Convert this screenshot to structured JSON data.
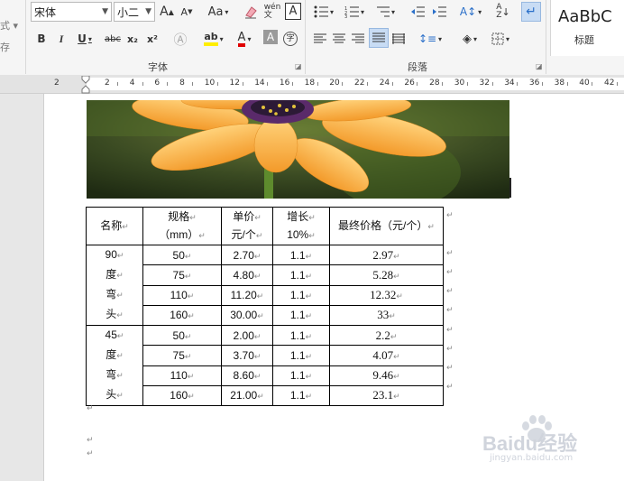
{
  "ribbon": {
    "left_cut": [
      "式 ▾",
      "存"
    ],
    "font_name": "宋体",
    "font_size": "小二",
    "grow_font": "A",
    "shrink_font": "A",
    "change_case": "Aa",
    "row1_icons": [
      "clear-format-icon",
      "phonetic-guide-icon",
      "char-border-icon"
    ],
    "bold": "B",
    "italic": "I",
    "underline": "U",
    "strike": "abc",
    "subscript": "x₂",
    "superscript": "x²",
    "group_font": "字体",
    "group_paragraph": "段落",
    "style_sample": "AaBbC",
    "style_name": "标题"
  },
  "ruler": {
    "labels": [
      "2",
      "2",
      "4",
      "6",
      "8",
      "10",
      "12",
      "14",
      "16",
      "18",
      "20",
      "22",
      "24",
      "26",
      "28",
      "30",
      "32",
      "34",
      "36",
      "38",
      "40",
      "42"
    ]
  },
  "table": {
    "headers": [
      [
        "名称",
        ""
      ],
      [
        "规格",
        "（mm）"
      ],
      [
        "单价",
        "元/个"
      ],
      [
        "增长",
        "10%"
      ],
      [
        "最终价格（元/个）",
        ""
      ]
    ],
    "group_labels": [
      [
        "90",
        "度",
        "弯",
        "头"
      ],
      [
        "45",
        "度",
        "弯",
        "头"
      ]
    ],
    "rows": [
      [
        "50",
        "2.70",
        "1.1",
        "2.97"
      ],
      [
        "75",
        "4.80",
        "1.1",
        "5.28"
      ],
      [
        "110",
        "11.20",
        "1.1",
        "12.32"
      ],
      [
        "160",
        "30.00",
        "1.1",
        "33"
      ],
      [
        "50",
        "2.00",
        "1.1",
        "2.2"
      ],
      [
        "75",
        "3.70",
        "1.1",
        "4.07"
      ],
      [
        "110",
        "8.60",
        "1.1",
        "9.46"
      ],
      [
        "160",
        "21.00",
        "1.1",
        "23.1"
      ]
    ],
    "mark": "↵"
  },
  "watermark": {
    "brand": "Baidu经验",
    "site": "jingyan.baidu.com"
  },
  "colors": {
    "ribbon_bg": "#f5f5f5",
    "selected": "#c8dcf4",
    "font_color_red": "#e00000",
    "highlight_yellow": "#ffee00"
  }
}
